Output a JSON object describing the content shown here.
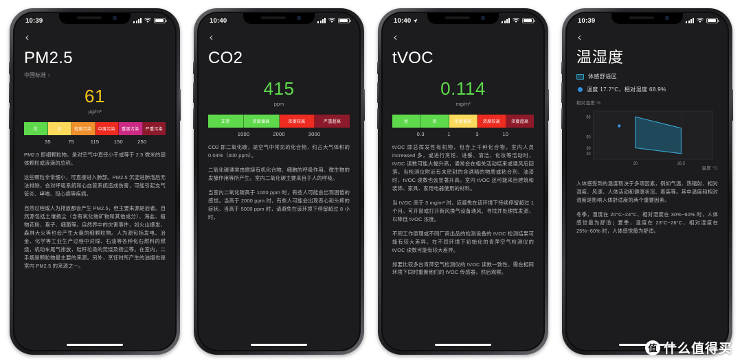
{
  "watermark": {
    "logo_char": "值",
    "text": "什么值得买"
  },
  "phones": [
    {
      "id": "pm25",
      "status": {
        "time": "10:39",
        "has_location": false,
        "signal": "signal-icon",
        "wifi": "wifi-icon",
        "battery": "battery-icon"
      },
      "back_glyph": "‹",
      "title": "PM2.5",
      "title_cjk": false,
      "subtitle": "中国标准",
      "subtitle_chevron": "›",
      "value": "61",
      "value_color": "#f5c518",
      "unit": "µg/m³",
      "gauge": {
        "segments": [
          {
            "label": "优",
            "color": "#5FD94C"
          },
          {
            "label": "良",
            "color": "#FBDA5C"
          },
          {
            "label": "轻度污染",
            "color": "#F0902C"
          },
          {
            "label": "中度污染",
            "color": "#ED2B20"
          },
          {
            "label": "重度污染",
            "color": "#CC2A84"
          },
          {
            "label": "严重污染",
            "color": "#8C1A2A"
          }
        ],
        "ticks": [
          "35",
          "75",
          "115",
          "150",
          "250"
        ]
      },
      "paragraphs": [
        "PM2.5 即细颗粒物，是对空气中直径小于或等于 2.5 微米的固体颗粒或液滴的总称。",
        "这些颗粒非常细小，可直接进入肺部。PM2.5 沉淀进肺泡后无法排除，会对呼吸系统和心血管系统造成伤害，可能引起支气管炎、哮喘、冠心病等疾病。",
        "自然过程或人为排放都会产生 PM2.5，但主要来源是后者。自然源包括土壤扬尘（含有氧化物矿物和其他成分）、海盐、植物花粉、孢子、细菌等。自然界中的灾害事件，如火山爆发、森林大火等也会产生大量的细颗粒物。人为源包括发电、冶金、化学等工业生产过程中对煤、石油等各种化石燃料的燃烧，机动车尾气排放，秸秆垃圾的焚烧及扬尘等。在室内，二手烟是颗粒物最主要的来源。另外，烹饪时所产生的油烟也是室内 PM2.5 的来源之一。"
      ]
    },
    {
      "id": "co2",
      "status": {
        "time": "10:40",
        "has_location": false,
        "signal": "signal-icon",
        "wifi": "wifi-icon",
        "battery": "battery-icon"
      },
      "back_glyph": "‹",
      "title": "CO2",
      "title_cjk": false,
      "subtitle": "",
      "subtitle_chevron": "",
      "value": "415",
      "value_color": "#5FD94C",
      "unit": "ppm",
      "gauge": {
        "segments": [
          {
            "label": "正常",
            "color": "#5FD94C"
          },
          {
            "label": "浓度偏高",
            "color": "#5FD94C"
          },
          {
            "label": "浓度较高",
            "color": "#ED2B20"
          },
          {
            "label": "严重超高",
            "color": "#8C1A2A"
          }
        ],
        "ticks": [
          "1000",
          "2000",
          "3000"
        ]
      },
      "paragraphs": [
        "CO2 即二氧化碳，是空气中常见的化合物，约占大气体积的 0.04%（400 ppm）。",
        "二氧化碳通常由燃烧有机化合物、细胞的呼吸作用、微生物的发酵作用等所产生。室内二氧化碳主要来自于人的呼吸。",
        "当室内二氧化碳高于 1000 ppm 时，有些人可能会出现困倦的感觉。当高于 2000 ppm 时，有些人可能会出现恶心和头疼的症状。当高于 5000 ppm 时，请避免在该环境下停留超过 8 小时。"
      ]
    },
    {
      "id": "tvoc",
      "status": {
        "time": "10:40",
        "has_location": true,
        "signal": "signal-icon",
        "wifi": "wifi-icon",
        "battery": "battery-icon"
      },
      "back_glyph": "‹",
      "title": "tVOC",
      "title_cjk": false,
      "subtitle": "",
      "subtitle_chevron": "",
      "value": "0.114",
      "value_color": "#5FD94C",
      "unit": "mg/m³",
      "gauge": {
        "segments": [
          {
            "label": "优",
            "color": "#5FD94C"
          },
          {
            "label": "良",
            "color": "#5FD94C"
          },
          {
            "label": "浓度偏高",
            "color": "#FBDA5C"
          },
          {
            "label": "浓度较高",
            "color": "#ED2B20"
          },
          {
            "label": "浓度超高",
            "color": "#8C1A2A"
          }
        ],
        "ticks": [
          "0.3",
          "1",
          "3",
          "10"
        ]
      },
      "paragraphs": [
        "tVOC 即总挥发性有机物，包含上千种化合物。室内人员increased 多，或进行烹饪、进餐、清洁、化妆等活动时，tVOC 读数可能大幅升高，通常会在相关活动结束或通风后回落。当检测仪附近有未密封的含酒精的物质或粘合剂、油漆时，tVOC 读数也会显著升高。室内 tVOC 还可能来自建筑和装饰、家具、家用电器使用的材料。",
        "当 tVOC 高于 3 mg/m³ 时，应避免在该环境下持续停留超过 1 个月。可开窗或打开新风换气设备通风、寻找并处理挥发源，以降低 tVOC 浓度。",
        "不同工作原理或不同厂商出品的检测设备的 tVOC 检测结果可能有较大差异。在不同环境下初始化的青萍空气检测仪的 tVOC 读数可能有较大差异。",
        "如要比较多台青萍空气检测仪的 tVOC 读数一致性，需在相同环境下同时重置他们的 tVOC 传感器，然后观察。"
      ]
    },
    {
      "id": "temp-humidity",
      "status": {
        "time": "10:39",
        "has_location": false,
        "signal": "signal-icon",
        "wifi": "wifi-icon",
        "battery": "battery-icon"
      },
      "back_glyph": "‹",
      "title": "温湿度",
      "title_cjk": true,
      "legend": [
        {
          "type": "zone",
          "label": "体感舒适区"
        },
        {
          "type": "dot",
          "label": "温度 17.7°C，相对湿度 68.9%"
        }
      ],
      "chart_data": {
        "type": "area",
        "title": "体感舒适区",
        "ylabel": "相对湿度 %",
        "xlabel": "温度 °C",
        "yticks": [
          85,
          50,
          30,
          20
        ],
        "ylim": [
          10,
          95
        ],
        "xticks": [
          20,
          26.5
        ],
        "xlim": [
          14,
          31
        ],
        "grid": true,
        "comfort_zone": [
          {
            "x": 20,
            "y": 85
          },
          {
            "x": 26.5,
            "y": 65
          },
          {
            "x": 26.5,
            "y": 20
          },
          {
            "x": 20,
            "y": 30
          }
        ],
        "zone_fill": "#1F6C88",
        "zone_stroke": "#3AA8D8",
        "point": {
          "x": 17.7,
          "y": 68.9,
          "color": "#3A96E8",
          "label": "温度 17.7°C，相对湿度 68.9%"
        }
      },
      "paragraphs": [
        "人体感受到的温度取决于多项因素，例如气温、热辐射、相对湿度、风速、人体活动和健康状况、着装等。其中温度和相对湿度是影响人体舒适度的两个重要因素。",
        "冬季，温度在 20°C~24°C、相对湿度在 30%~60% 时，人体感觉最为舒适；夏季，温度在 23°C~26°C、相对湿度在 25%~60% 时，人体感觉最为舒适。"
      ]
    }
  ]
}
